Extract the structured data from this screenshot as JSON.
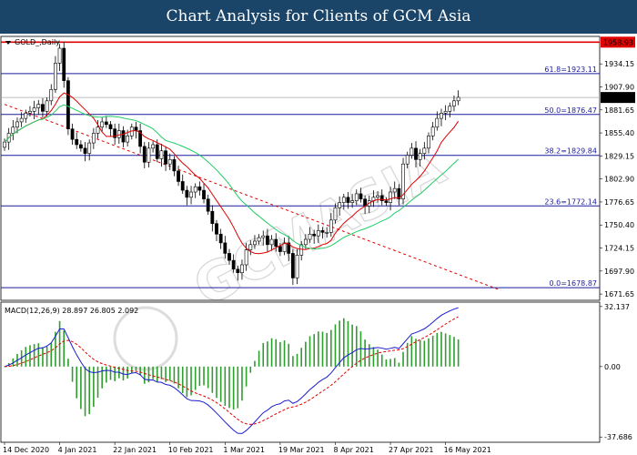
{
  "header": {
    "title": "Chart Analysis for Clients of GCM Asia"
  },
  "chart_data": {
    "type": "candlestick",
    "symbol_label": "GOLD_,Daily",
    "price_axis": {
      "ylim": [
        1664.5,
        1965.5
      ],
      "ticks": [
        1934.15,
        1907.9,
        1881.65,
        1855.4,
        1829.15,
        1802.9,
        1776.65,
        1750.4,
        1724.15,
        1697.9,
        1671.65
      ]
    },
    "x_axis": {
      "dates": [
        "14 Dec 2020",
        "4 Jan 2021",
        "22 Jan 2021",
        "10 Feb 2021",
        "1 Mar 2021",
        "19 Mar 2021",
        "8 Apr 2021",
        "27 Apr 2021",
        "16 May 2021"
      ],
      "date_bar_index": [
        0,
        13,
        26,
        39,
        52,
        65,
        78,
        91,
        104
      ]
    },
    "fibonacci": [
      {
        "label": "61.8=1923.11",
        "value": 1923.11
      },
      {
        "label": "50.0=1876.47",
        "value": 1876.47
      },
      {
        "label": "38.2=1829.84",
        "value": 1829.84
      },
      {
        "label": "23.6=1772.14",
        "value": 1772.14
      },
      {
        "label": "0.0=1678.87",
        "value": 1678.87
      }
    ],
    "resistance": {
      "value": 1958.93,
      "label": "1958.93",
      "color": "#e00000"
    },
    "current_price": {
      "value": 1895.82,
      "label": "1895.82"
    },
    "trendline": {
      "from": {
        "bar": 0,
        "price": 1888.0
      },
      "to": {
        "bar": 117,
        "price": 1676.0
      },
      "color": "#e00000"
    },
    "closes": [
      1845,
      1855,
      1862,
      1868,
      1872,
      1878,
      1880,
      1884,
      1888,
      1880,
      1892,
      1905,
      1935,
      1952,
      1915,
      1860,
      1848,
      1842,
      1838,
      1832,
      1844,
      1855,
      1862,
      1868,
      1865,
      1860,
      1850,
      1858,
      1845,
      1852,
      1862,
      1858,
      1840,
      1822,
      1838,
      1842,
      1826,
      1835,
      1820,
      1825,
      1812,
      1800,
      1790,
      1782,
      1788,
      1794,
      1790,
      1780,
      1766,
      1752,
      1740,
      1730,
      1718,
      1710,
      1700,
      1696,
      1705,
      1722,
      1728,
      1732,
      1736,
      1738,
      1728,
      1734,
      1726,
      1720,
      1730,
      1718,
      1690,
      1716,
      1728,
      1734,
      1740,
      1738,
      1744,
      1742,
      1742,
      1756,
      1770,
      1776,
      1782,
      1776,
      1778,
      1786,
      1780,
      1772,
      1778,
      1782,
      1784,
      1778,
      1776,
      1788,
      1792,
      1780,
      1820,
      1830,
      1838,
      1825,
      1832,
      1838,
      1852,
      1862,
      1872,
      1878,
      1880,
      1886,
      1892,
      1896
    ],
    "indicators": {
      "ma_fast": {
        "color": "#e00000"
      },
      "ma_slow": {
        "color": "#22cc66"
      }
    },
    "macd": {
      "label": "MACD(12,26,9) 28.897 26.805 2.092",
      "params": [
        12,
        26,
        9
      ],
      "macd_value": 28.897,
      "signal_value": 26.805,
      "histogram_value": 2.092,
      "ylim": [
        -40.5,
        34.5
      ],
      "ticks": [
        32.137,
        0.0,
        -37.686
      ]
    }
  }
}
